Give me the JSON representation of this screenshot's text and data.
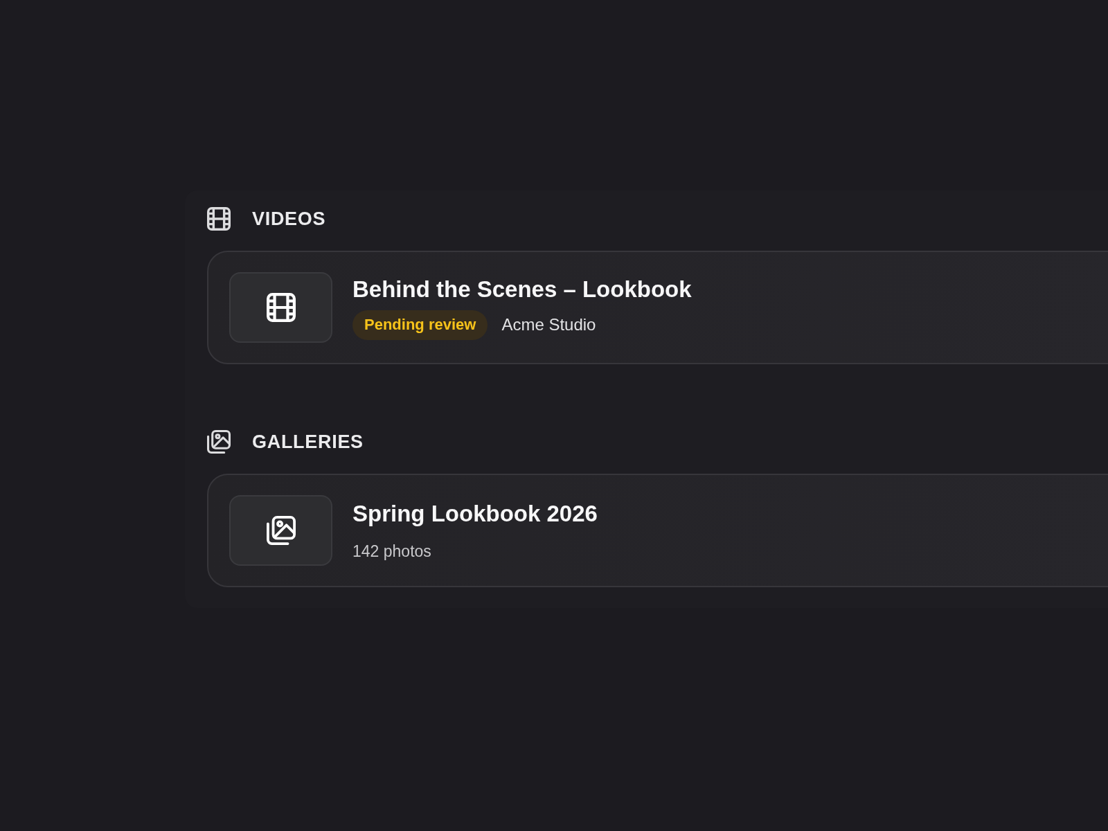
{
  "sections": [
    {
      "kind": "videos",
      "title": "VIDEOS",
      "items": [
        {
          "title": "Behind the Scenes – Lookbook",
          "status": {
            "label": "Pending review",
            "kind": "pending"
          },
          "meta": "Acme Studio"
        }
      ]
    },
    {
      "kind": "galleries",
      "title": "GALLERIES",
      "items": [
        {
          "title": "Spring Lookbook 2026",
          "meta": "142 photos"
        }
      ]
    }
  ]
}
